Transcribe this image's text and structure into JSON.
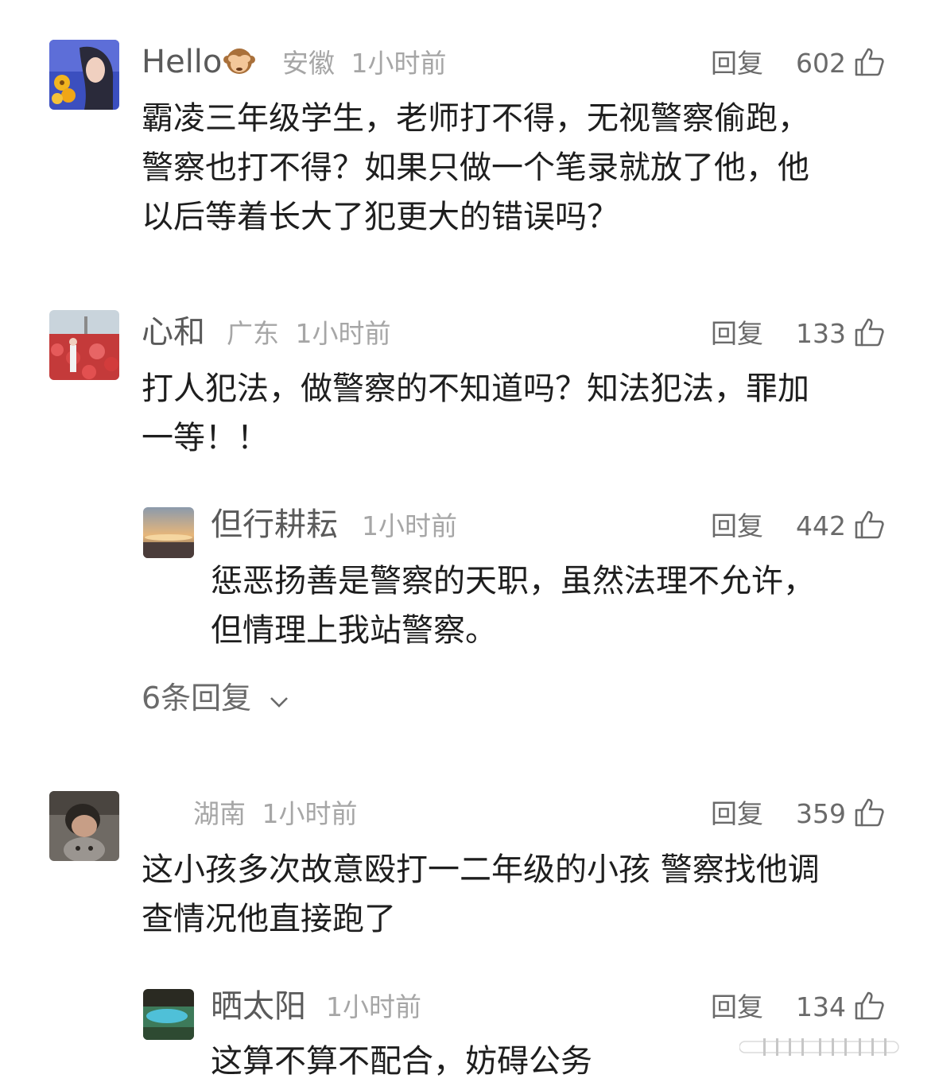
{
  "comments": [
    {
      "author": "Hello",
      "author_emoji": "see-no-evil-monkey-icon",
      "location": "安徽",
      "time": "1小时前",
      "reply_label": "回复",
      "likes": "602",
      "lines": [
        "霸凌三年级学生，老师打不得，无视警察偷跑，",
        "警察也打不得？如果只做一个笔录就放了他，他",
        "以后等着长大了犯更大的错误吗？"
      ]
    },
    {
      "author": "心和",
      "location": "广东",
      "time": "1小时前",
      "reply_label": "回复",
      "likes": "133",
      "lines": [
        "打人犯法，做警察的不知道吗？知法犯法，罪加",
        "一等！！"
      ],
      "sub_reply": {
        "author": "但行耕耘",
        "time": "1小时前",
        "reply_label": "回复",
        "likes": "442",
        "lines": [
          "惩恶扬善是警察的天职，虽然法理不允许，",
          "但情理上我站警察。"
        ]
      },
      "more_replies": "6条回复"
    },
    {
      "author": "",
      "location": "湖南",
      "time": "1小时前",
      "reply_label": "回复",
      "likes": "359",
      "lines": [
        "这小孩多次故意殴打一二年级的小孩 警察找他调",
        "查情况他直接跑了"
      ],
      "sub_reply": {
        "author": "晒太阳",
        "time": "1小时前",
        "reply_label": "回复",
        "likes": "134",
        "lines": [
          "这算不算不配合，妨碍公务"
        ]
      }
    }
  ],
  "icons": {
    "like": "thumbs-up-icon",
    "expand": "chevron-down-icon"
  }
}
